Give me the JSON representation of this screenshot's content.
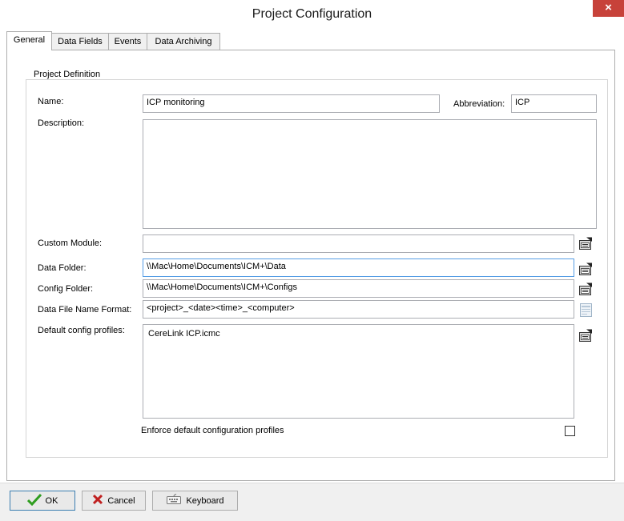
{
  "window": {
    "title": "Project Configuration",
    "close_glyph": "×"
  },
  "tabs": [
    {
      "label": "General",
      "active": true
    },
    {
      "label": "Data Fields",
      "active": false
    },
    {
      "label": "Events",
      "active": false
    },
    {
      "label": "Data Archiving",
      "active": false
    }
  ],
  "project_definition": {
    "group_title": "Project Definition",
    "name_label": "Name:",
    "name_value": "ICP monitoring",
    "abbreviation_label": "Abbreviation:",
    "abbreviation_value": "ICP",
    "description_label": "Description:",
    "description_value": "",
    "custom_module_label": "Custom Module:",
    "custom_module_value": "",
    "data_folder_label": "Data Folder:",
    "data_folder_value": "\\\\Mac\\Home\\Documents\\ICM+\\Data",
    "config_folder_label": "Config Folder:",
    "config_folder_value": "\\\\Mac\\Home\\Documents\\ICM+\\Configs",
    "file_name_format_label": "Data File Name Format:",
    "file_name_format_value": "<project>_<date><time>_<computer>",
    "default_profiles_label": "Default config profiles:",
    "default_profiles": [
      "CereLink ICP.icmc"
    ],
    "enforce_label": "Enforce default configuration profiles",
    "enforce_checked": false
  },
  "buttons": {
    "ok": "OK",
    "cancel": "Cancel",
    "keyboard": "Keyboard"
  },
  "colors": {
    "close_bg": "#c7423a",
    "ok_check": "#2e9d1f",
    "cancel_x": "#c02020",
    "focus_border": "#569de5"
  },
  "icons": {
    "folder_browse": "folder-properties-icon",
    "format_editor": "format-editor-icon",
    "ok": "checkmark-icon",
    "cancel": "x-icon",
    "keyboard": "keyboard-icon"
  }
}
